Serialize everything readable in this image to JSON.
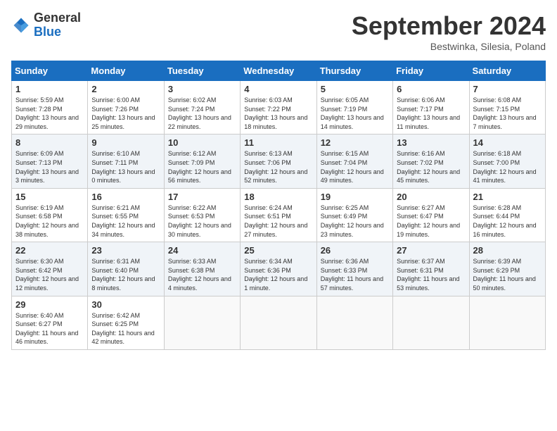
{
  "header": {
    "logo_general": "General",
    "logo_blue": "Blue",
    "month": "September 2024",
    "location": "Bestwinka, Silesia, Poland"
  },
  "days_of_week": [
    "Sunday",
    "Monday",
    "Tuesday",
    "Wednesday",
    "Thursday",
    "Friday",
    "Saturday"
  ],
  "weeks": [
    [
      {
        "day": "1",
        "text": "Sunrise: 5:59 AM\nSunset: 7:28 PM\nDaylight: 13 hours and 29 minutes."
      },
      {
        "day": "2",
        "text": "Sunrise: 6:00 AM\nSunset: 7:26 PM\nDaylight: 13 hours and 25 minutes."
      },
      {
        "day": "3",
        "text": "Sunrise: 6:02 AM\nSunset: 7:24 PM\nDaylight: 13 hours and 22 minutes."
      },
      {
        "day": "4",
        "text": "Sunrise: 6:03 AM\nSunset: 7:22 PM\nDaylight: 13 hours and 18 minutes."
      },
      {
        "day": "5",
        "text": "Sunrise: 6:05 AM\nSunset: 7:19 PM\nDaylight: 13 hours and 14 minutes."
      },
      {
        "day": "6",
        "text": "Sunrise: 6:06 AM\nSunset: 7:17 PM\nDaylight: 13 hours and 11 minutes."
      },
      {
        "day": "7",
        "text": "Sunrise: 6:08 AM\nSunset: 7:15 PM\nDaylight: 13 hours and 7 minutes."
      }
    ],
    [
      {
        "day": "8",
        "text": "Sunrise: 6:09 AM\nSunset: 7:13 PM\nDaylight: 13 hours and 3 minutes."
      },
      {
        "day": "9",
        "text": "Sunrise: 6:10 AM\nSunset: 7:11 PM\nDaylight: 13 hours and 0 minutes."
      },
      {
        "day": "10",
        "text": "Sunrise: 6:12 AM\nSunset: 7:09 PM\nDaylight: 12 hours and 56 minutes."
      },
      {
        "day": "11",
        "text": "Sunrise: 6:13 AM\nSunset: 7:06 PM\nDaylight: 12 hours and 52 minutes."
      },
      {
        "day": "12",
        "text": "Sunrise: 6:15 AM\nSunset: 7:04 PM\nDaylight: 12 hours and 49 minutes."
      },
      {
        "day": "13",
        "text": "Sunrise: 6:16 AM\nSunset: 7:02 PM\nDaylight: 12 hours and 45 minutes."
      },
      {
        "day": "14",
        "text": "Sunrise: 6:18 AM\nSunset: 7:00 PM\nDaylight: 12 hours and 41 minutes."
      }
    ],
    [
      {
        "day": "15",
        "text": "Sunrise: 6:19 AM\nSunset: 6:58 PM\nDaylight: 12 hours and 38 minutes."
      },
      {
        "day": "16",
        "text": "Sunrise: 6:21 AM\nSunset: 6:55 PM\nDaylight: 12 hours and 34 minutes."
      },
      {
        "day": "17",
        "text": "Sunrise: 6:22 AM\nSunset: 6:53 PM\nDaylight: 12 hours and 30 minutes."
      },
      {
        "day": "18",
        "text": "Sunrise: 6:24 AM\nSunset: 6:51 PM\nDaylight: 12 hours and 27 minutes."
      },
      {
        "day": "19",
        "text": "Sunrise: 6:25 AM\nSunset: 6:49 PM\nDaylight: 12 hours and 23 minutes."
      },
      {
        "day": "20",
        "text": "Sunrise: 6:27 AM\nSunset: 6:47 PM\nDaylight: 12 hours and 19 minutes."
      },
      {
        "day": "21",
        "text": "Sunrise: 6:28 AM\nSunset: 6:44 PM\nDaylight: 12 hours and 16 minutes."
      }
    ],
    [
      {
        "day": "22",
        "text": "Sunrise: 6:30 AM\nSunset: 6:42 PM\nDaylight: 12 hours and 12 minutes."
      },
      {
        "day": "23",
        "text": "Sunrise: 6:31 AM\nSunset: 6:40 PM\nDaylight: 12 hours and 8 minutes."
      },
      {
        "day": "24",
        "text": "Sunrise: 6:33 AM\nSunset: 6:38 PM\nDaylight: 12 hours and 4 minutes."
      },
      {
        "day": "25",
        "text": "Sunrise: 6:34 AM\nSunset: 6:36 PM\nDaylight: 12 hours and 1 minute."
      },
      {
        "day": "26",
        "text": "Sunrise: 6:36 AM\nSunset: 6:33 PM\nDaylight: 11 hours and 57 minutes."
      },
      {
        "day": "27",
        "text": "Sunrise: 6:37 AM\nSunset: 6:31 PM\nDaylight: 11 hours and 53 minutes."
      },
      {
        "day": "28",
        "text": "Sunrise: 6:39 AM\nSunset: 6:29 PM\nDaylight: 11 hours and 50 minutes."
      }
    ],
    [
      {
        "day": "29",
        "text": "Sunrise: 6:40 AM\nSunset: 6:27 PM\nDaylight: 11 hours and 46 minutes."
      },
      {
        "day": "30",
        "text": "Sunrise: 6:42 AM\nSunset: 6:25 PM\nDaylight: 11 hours and 42 minutes."
      },
      {
        "day": "",
        "text": ""
      },
      {
        "day": "",
        "text": ""
      },
      {
        "day": "",
        "text": ""
      },
      {
        "day": "",
        "text": ""
      },
      {
        "day": "",
        "text": ""
      }
    ]
  ]
}
